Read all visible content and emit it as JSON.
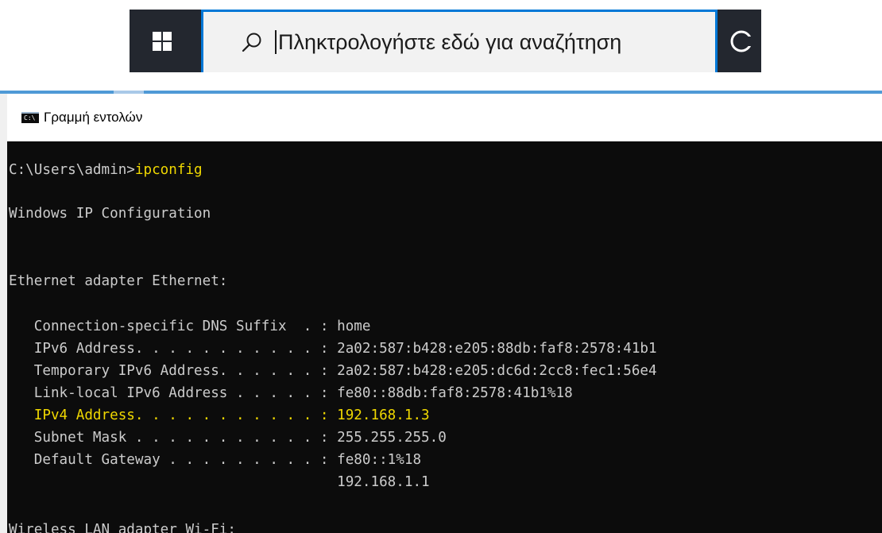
{
  "taskbar": {
    "start_icon": "windows-logo-icon",
    "search_icon": "search-icon",
    "search_placeholder": "Πληκτρολογήστε εδώ για αναζήτηση",
    "cortana_icon": "cortana-icon"
  },
  "window": {
    "title": "Γραμμή εντολών",
    "icon_text": "C:\\"
  },
  "console": {
    "prompt": "C:\\Users\\admin>",
    "command": "ipconfig",
    "header": "Windows IP Configuration",
    "adapter1": "Ethernet adapter Ethernet:",
    "rows": [
      {
        "label": "   Connection-specific DNS Suffix  . : ",
        "value": "home"
      },
      {
        "label": "   IPv6 Address. . . . . . . . . . . : ",
        "value": "2a02:587:b428:e205:88db:faf8:2578:41b1"
      },
      {
        "label": "   Temporary IPv6 Address. . . . . . : ",
        "value": "2a02:587:b428:e205:dc6d:2cc8:fec1:56e4"
      },
      {
        "label": "   Link-local IPv6 Address . . . . . : ",
        "value": "fe80::88db:faf8:2578:41b1%18"
      },
      {
        "label": "   IPv4 Address. . . . . . . . . . . : ",
        "value": "192.168.1.3"
      },
      {
        "label": "   Subnet Mask . . . . . . . . . . . : ",
        "value": "255.255.255.0"
      },
      {
        "label": "   Default Gateway . . . . . . . . . : ",
        "value": "fe80::1%18"
      },
      {
        "label": "                                       ",
        "value": "192.168.1.1"
      }
    ],
    "adapter2": "Wireless LAN adapter Wi-Fi:",
    "highlight_color": "#f0d800",
    "text_color": "#cccccc",
    "background_color": "#0c0c0c"
  }
}
